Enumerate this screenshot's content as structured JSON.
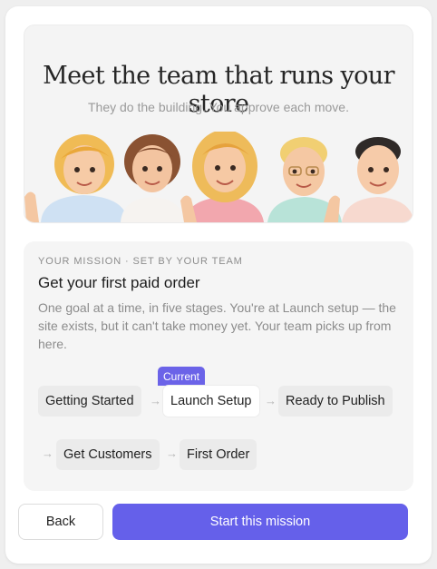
{
  "hero": {
    "title": "Meet the team that runs your store",
    "subtitle": "They do the building. You approve each move."
  },
  "mission": {
    "eyebrow": "YOUR MISSION · SET BY YOUR TEAM",
    "title": "Get your first paid order",
    "description": "One goal at a time, in five stages. You're at Launch setup — the site exists, but it can't take money yet. Your team picks up from here.",
    "current_badge": "Current",
    "stages": [
      {
        "label": "Getting Started",
        "current": false
      },
      {
        "label": "Launch Setup",
        "current": true
      },
      {
        "label": "Ready to Publish",
        "current": false
      },
      {
        "label": "Get Customers",
        "current": false
      },
      {
        "label": "First Order",
        "current": false
      }
    ],
    "arrow_glyph": "→"
  },
  "actions": {
    "back_label": "Back",
    "start_label": "Start this mission"
  },
  "colors": {
    "accent": "#6560ea",
    "badge": "#6b63e8"
  }
}
